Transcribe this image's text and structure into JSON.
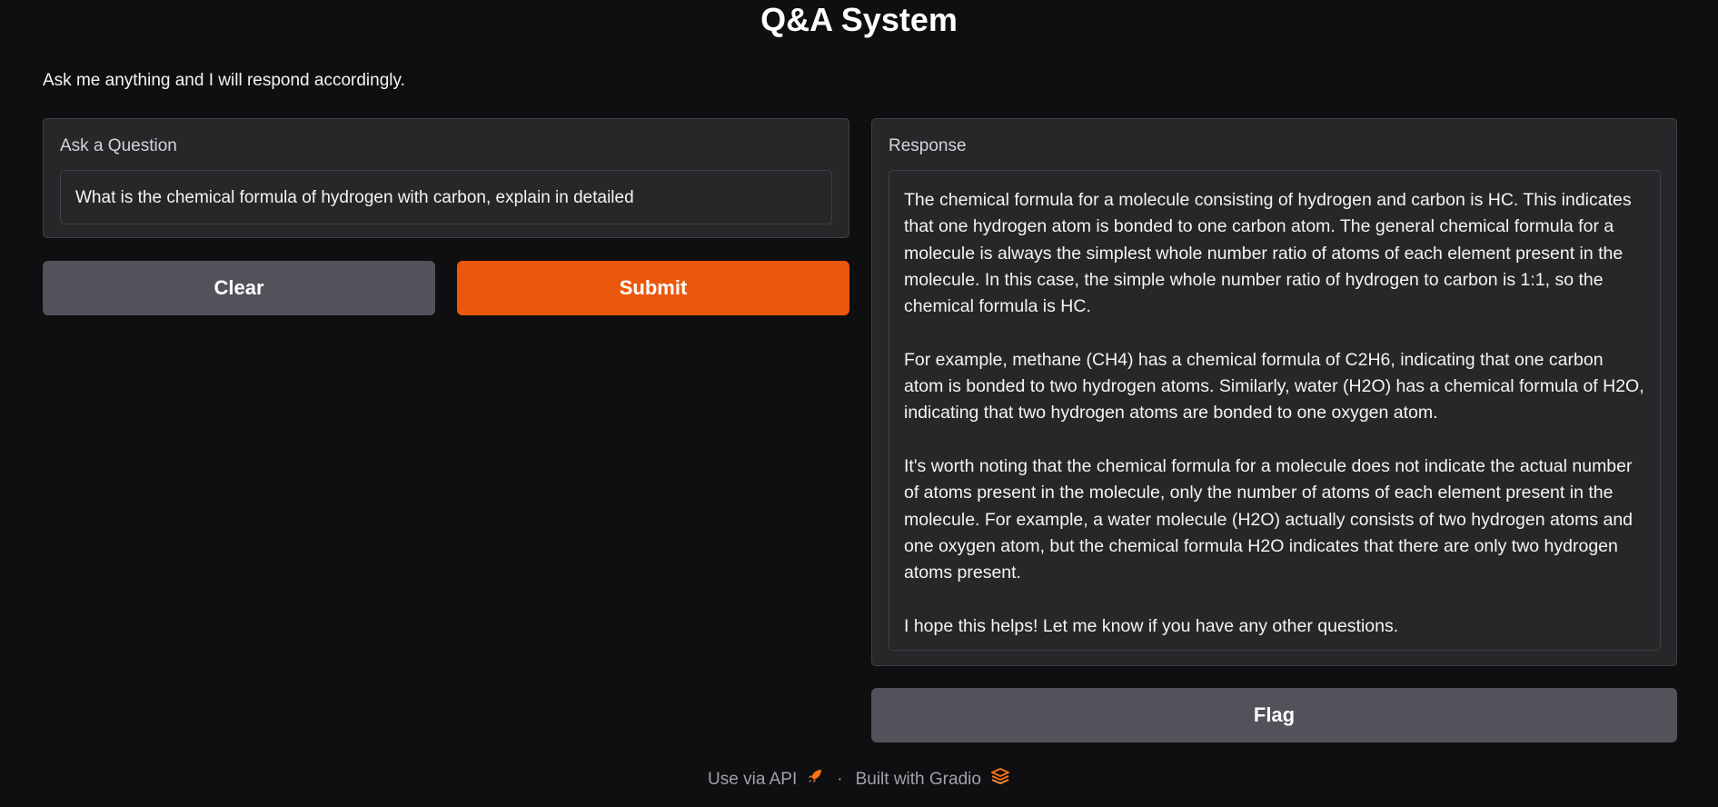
{
  "app": {
    "title": "Q&A System",
    "description": "Ask me anything and I will respond accordingly."
  },
  "question": {
    "label": "Ask a Question",
    "value": "What is the chemical formula of hydrogen with carbon, explain in detailed"
  },
  "buttons": {
    "clear_label": "Clear",
    "submit_label": "Submit",
    "flag_label": "Flag"
  },
  "response": {
    "label": "Response",
    "paragraphs": [
      "The chemical formula for a molecule consisting of hydrogen and carbon is HC. This indicates that one hydrogen atom is bonded to one carbon atom. The general chemical formula for a molecule is always the simplest whole number ratio of atoms of each element present in the molecule. In this case, the simple whole number ratio of hydrogen to carbon is 1:1, so the chemical formula is HC.",
      "For example, methane (CH4) has a chemical formula of C2H6, indicating that one carbon atom is bonded to two hydrogen atoms. Similarly, water (H2O) has a chemical formula of H2O, indicating that two hydrogen atoms are bonded to one oxygen atom.",
      "It's worth noting that the chemical formula for a molecule does not indicate the actual number of atoms present in the molecule, only the number of atoms of each element present in the molecule. For example, a water molecule (H2O) actually consists of two hydrogen atoms and one oxygen atom, but the chemical formula H2O indicates that there are only two hydrogen atoms present.",
      "I hope this helps! Let me know if you have any other questions."
    ]
  },
  "footer": {
    "api_label": "Use via API",
    "api_icon": "rocket-icon",
    "separator": "·",
    "built_label": "Built with Gradio",
    "built_icon": "gradio-logo-icon"
  },
  "colors": {
    "background": "#0f0f11",
    "panel": "#27272a",
    "primary": "#ea580c",
    "secondary": "#52525b"
  }
}
